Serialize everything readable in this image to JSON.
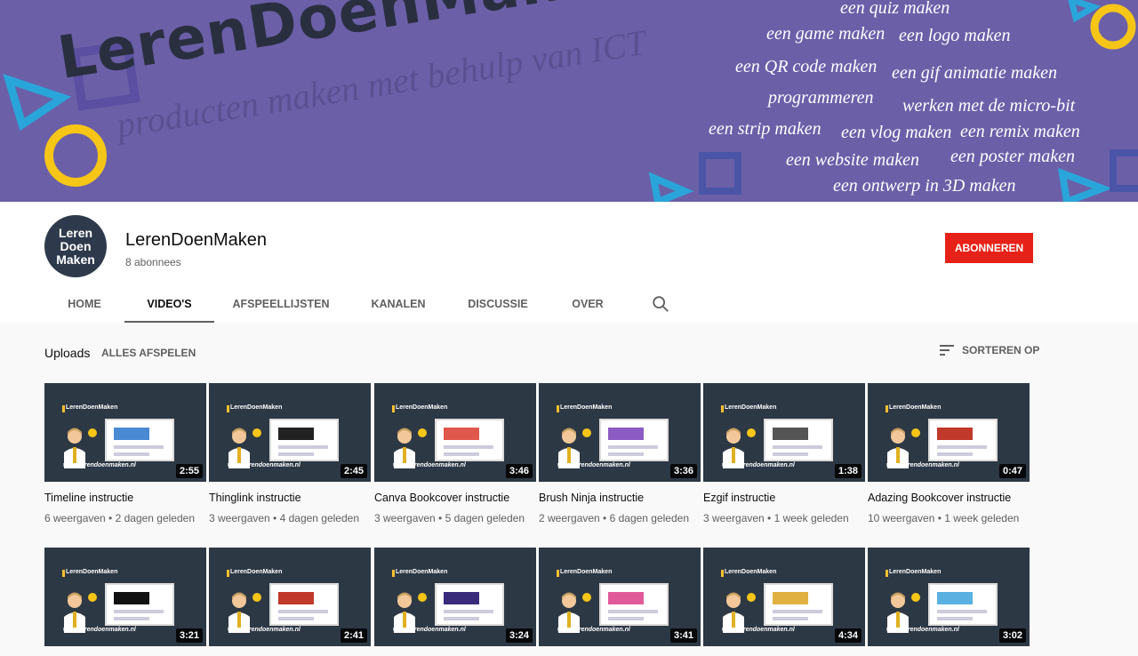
{
  "banner": {
    "title": "LerenDoenMaken",
    "subtitle": "producten maken met behulp van ICT",
    "tags": [
      "een quiz maken",
      "een game maken",
      "een logo maken",
      "een QR code maken",
      "een gif animatie maken",
      "programmeren",
      "werken met de micro-bit",
      "een strip maken",
      "een vlog maken",
      "een remix maken",
      "een website maken",
      "een poster maken",
      "een ontwerp in 3D maken"
    ]
  },
  "channel": {
    "avatar_line1": "Leren",
    "avatar_line2": "Doen",
    "avatar_line3": "Maken",
    "name": "LerenDoenMaken",
    "subscribers": "8 abonnees",
    "subscribe_label": "ABONNEREN"
  },
  "tabs": [
    {
      "label": "HOME",
      "active": false
    },
    {
      "label": "VIDEO'S",
      "active": true
    },
    {
      "label": "AFSPEELLIJSTEN",
      "active": false
    },
    {
      "label": "KANALEN",
      "active": false
    },
    {
      "label": "DISCUSSIE",
      "active": false
    },
    {
      "label": "OVER",
      "active": false
    }
  ],
  "uploads": {
    "label": "Uploads",
    "play_all": "ALLES AFSPELEN",
    "sort": "SORTEREN OP"
  },
  "thumb_brand": "LerenDoenMaken",
  "thumb_url": "www.lerendoenmaken.nl",
  "videos": [
    {
      "title": "Timeline instructie",
      "meta": "6 weergaven • 2 dagen geleden",
      "duration": "2:55",
      "accent": "#4a8ad4"
    },
    {
      "title": "Thinglink instructie",
      "meta": "3 weergaven • 4 dagen geleden",
      "duration": "2:45",
      "accent": "#222222"
    },
    {
      "title": "Canva Bookcover instructie",
      "meta": "3 weergaven • 5 dagen geleden",
      "duration": "3:46",
      "accent": "#e0584c"
    },
    {
      "title": "Brush Ninja instructie",
      "meta": "2 weergaven • 6 dagen geleden",
      "duration": "3:36",
      "accent": "#8c5cc4"
    },
    {
      "title": "Ezgif instructie",
      "meta": "3 weergaven • 1 week geleden",
      "duration": "1:38",
      "accent": "#555555"
    },
    {
      "title": "Adazing Bookcover instructie",
      "meta": "10 weergaven • 1 week geleden",
      "duration": "0:47",
      "accent": "#c0392b"
    },
    {
      "title": "",
      "meta": "",
      "duration": "3:21",
      "accent": "#111111"
    },
    {
      "title": "",
      "meta": "",
      "duration": "2:41",
      "accent": "#c0392b"
    },
    {
      "title": "",
      "meta": "",
      "duration": "3:24",
      "accent": "#3a2a7a"
    },
    {
      "title": "",
      "meta": "",
      "duration": "3:41",
      "accent": "#e05a9a"
    },
    {
      "title": "",
      "meta": "",
      "duration": "4:34",
      "accent": "#e0b040"
    },
    {
      "title": "",
      "meta": "",
      "duration": "3:02",
      "accent": "#5ab0e0"
    }
  ]
}
